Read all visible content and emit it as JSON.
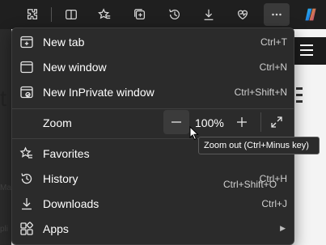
{
  "toolbar": {
    "buttons": [
      {
        "name": "extensions-icon"
      },
      {
        "name": "split-screen-icon"
      },
      {
        "name": "favorites-star-icon"
      },
      {
        "name": "collections-icon"
      },
      {
        "name": "history-icon"
      },
      {
        "name": "downloads-icon"
      },
      {
        "name": "browser-essentials-icon"
      },
      {
        "name": "more-icon"
      },
      {
        "name": "copilot-icon"
      }
    ]
  },
  "menu": {
    "new_tab": {
      "label": "New tab",
      "shortcut": "Ctrl+T"
    },
    "new_window": {
      "label": "New window",
      "shortcut": "Ctrl+N"
    },
    "new_inprivate": {
      "label": "New InPrivate window",
      "shortcut": "Ctrl+Shift+N"
    },
    "zoom": {
      "label": "Zoom",
      "value": "100%"
    },
    "favorites": {
      "label": "Favorites",
      "shortcut": "Ctrl+Shift+O"
    },
    "history": {
      "label": "History",
      "shortcut": "Ctrl+H"
    },
    "downloads": {
      "label": "Downloads",
      "shortcut": "Ctrl+J"
    },
    "apps": {
      "label": "Apps"
    }
  },
  "tooltip": {
    "text": "Zoom out (Ctrl+Minus key)"
  },
  "page": {
    "frag_t": "t",
    "frag_ma": "Ma",
    "frag_pl": "pli"
  }
}
